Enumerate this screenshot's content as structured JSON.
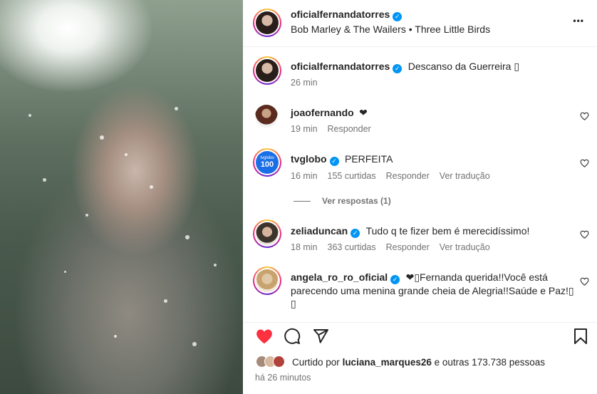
{
  "header": {
    "username": "oficialfernandatorres",
    "subtitle": "Bob Marley & The Wailers • Three Little Birds",
    "more_label": "•••"
  },
  "caption": {
    "username": "oficialfernandatorres",
    "text": "Descanso da Guerreira ▯",
    "time": "26 min"
  },
  "comments": [
    {
      "username": "joaofernando",
      "text": "❤",
      "time": "19 min",
      "reply": "Responder"
    },
    {
      "username": "tvglobo",
      "text": "PERFEITA",
      "time": "16 min",
      "likes": "155 curtidas",
      "reply": "Responder",
      "translate": "Ver tradução"
    },
    {
      "username": "zeliaduncan",
      "text": "Tudo q te fizer bem é merecidíssimo!",
      "time": "18 min",
      "likes": "363 curtidas",
      "reply": "Responder",
      "translate": "Ver tradução"
    },
    {
      "username": "angela_ro_ro_oficial",
      "text_line1": "❤▯Fernanda querida!!Você está",
      "text_line2": "parecendo uma menina grande cheia de Alegria!!Saúde e Paz!▯",
      "text_line3": "▯"
    }
  ],
  "view_replies": "Ver respostas (1)",
  "tvglobo_badge": "tvglobo",
  "tvglobo_number": "100",
  "likes_summary": {
    "prefix": "Curtido por",
    "user": "luciana_marques26",
    "suffix": "e outras 173.738 pessoas",
    "time": "há 26 minutos"
  },
  "colors": {
    "heart_red": "#ff3040",
    "verified_blue": "#0095f6",
    "meta_gray": "#737373"
  }
}
